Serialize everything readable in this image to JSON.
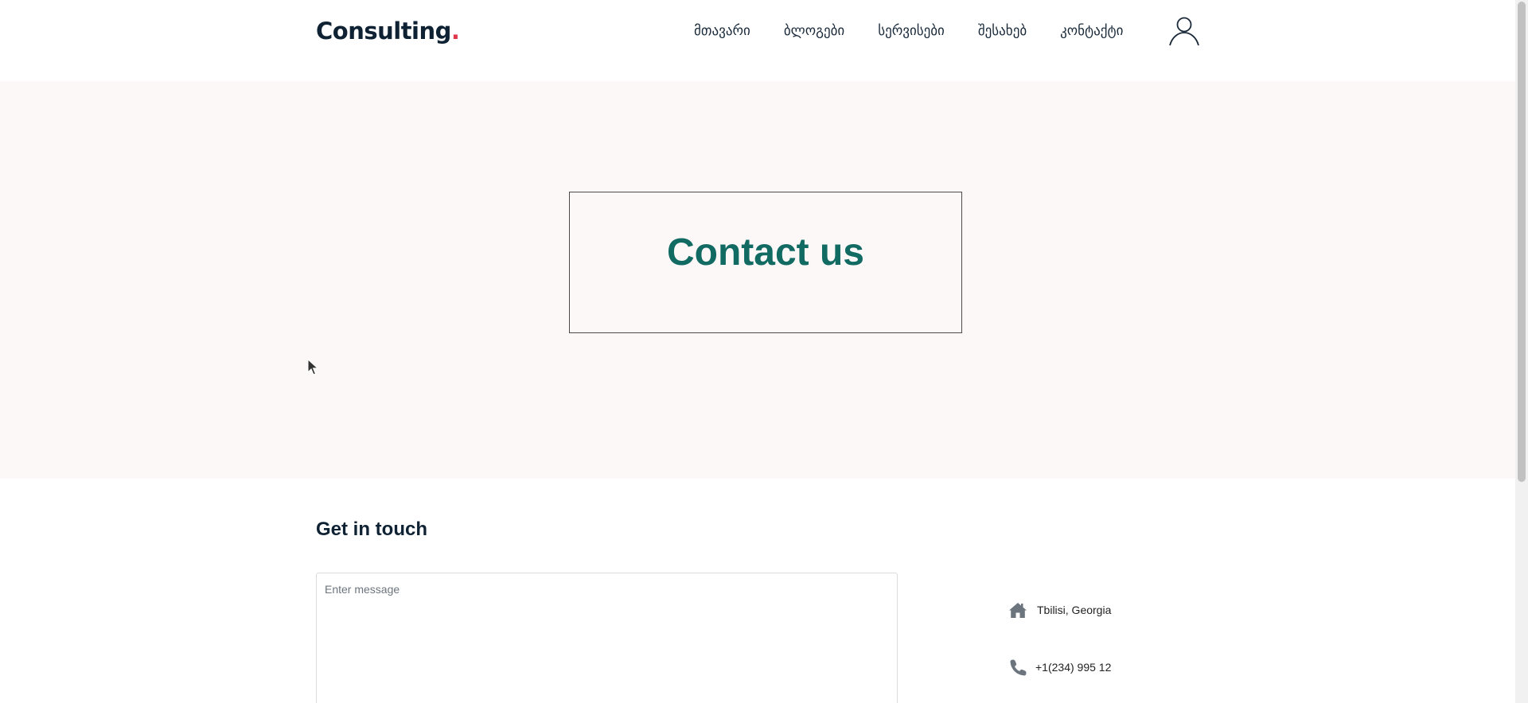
{
  "header": {
    "logo_text": "Consulting",
    "logo_dot": ".",
    "nav": [
      {
        "label": "მთავარი"
      },
      {
        "label": "ბლოგები"
      },
      {
        "label": "სერვისები"
      },
      {
        "label": "შესახებ"
      },
      {
        "label": "კონტაქტი"
      }
    ],
    "user_icon": "user-icon"
  },
  "hero": {
    "title": "Contact us"
  },
  "contact": {
    "section_title": "Get in touch",
    "message_placeholder": "Enter message",
    "address": "Tbilisi, Georgia",
    "phone": "+1(234) 995 12"
  },
  "icons": {
    "address": "home-icon",
    "phone": "phone-icon"
  },
  "colors": {
    "brand_dark": "#0f2233",
    "brand_accent": "#e0384b",
    "hero_title": "#126b63",
    "hero_bg": "#fdf8f8"
  }
}
